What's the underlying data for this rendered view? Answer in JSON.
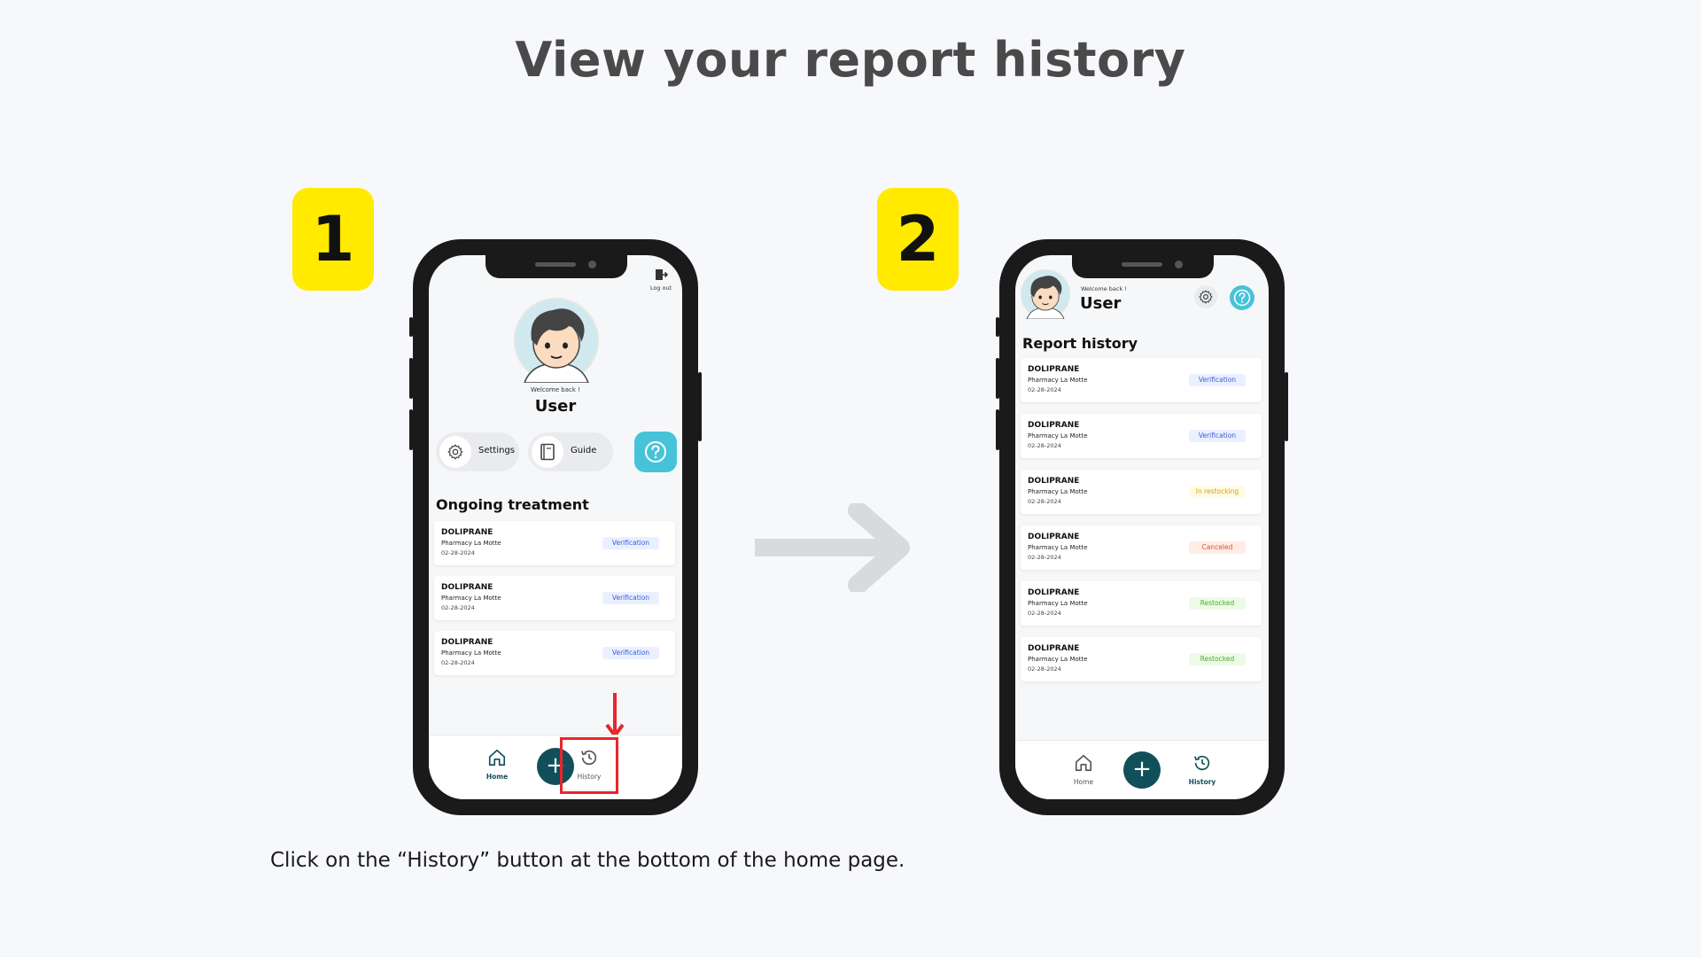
{
  "page": {
    "title": "View your report history",
    "caption": "Click on the “History” button at the bottom of the home page."
  },
  "steps": [
    "1",
    "2"
  ],
  "colors": {
    "badge": "#ffea00",
    "accent": "#46c3d9",
    "primary": "#11505a",
    "highlight": "#e8262b"
  },
  "phone1": {
    "logout_label": "Log out",
    "welcome": "Welcome back !",
    "username": "User",
    "settings_label": "Settings",
    "guide_label": "Guide",
    "section_title": "Ongoing treatment",
    "cards": [
      {
        "name": "DOLIPRANE",
        "pharmacy": "Pharmacy La Motte",
        "date": "02-28-2024",
        "status": "Verification"
      },
      {
        "name": "DOLIPRANE",
        "pharmacy": "Pharmacy La Motte",
        "date": "02-28-2024",
        "status": "Verification"
      },
      {
        "name": "DOLIPRANE",
        "pharmacy": "Pharmacy La Motte",
        "date": "02-28-2024",
        "status": "Verification"
      }
    ],
    "tabs": {
      "home": "Home",
      "history": "History"
    }
  },
  "phone2": {
    "welcome": "Welcome back !",
    "username": "User",
    "section_title": "Report history",
    "cards": [
      {
        "name": "DOLIPRANE",
        "pharmacy": "Pharmacy La Motte",
        "date": "02-28-2024",
        "status": "Verification"
      },
      {
        "name": "DOLIPRANE",
        "pharmacy": "Pharmacy La Motte",
        "date": "02-28-2024",
        "status": "Verification"
      },
      {
        "name": "DOLIPRANE",
        "pharmacy": "Pharmacy La Motte",
        "date": "02-28-2024",
        "status": "In restocking"
      },
      {
        "name": "DOLIPRANE",
        "pharmacy": "Pharmacy La Motte",
        "date": "02-28-2024",
        "status": "Canceled"
      },
      {
        "name": "DOLIPRANE",
        "pharmacy": "Pharmacy La Motte",
        "date": "02-28-2024",
        "status": "Restocked"
      },
      {
        "name": "DOLIPRANE",
        "pharmacy": "Pharmacy La Motte",
        "date": "02-28-2024",
        "status": "Restocked"
      }
    ],
    "tabs": {
      "home": "Home",
      "history": "History"
    }
  },
  "icons": [
    "logout-icon",
    "gear-icon",
    "book-icon",
    "help-icon",
    "home-icon",
    "plus-icon",
    "history-icon",
    "arrow-right-icon",
    "arrow-down-icon"
  ]
}
